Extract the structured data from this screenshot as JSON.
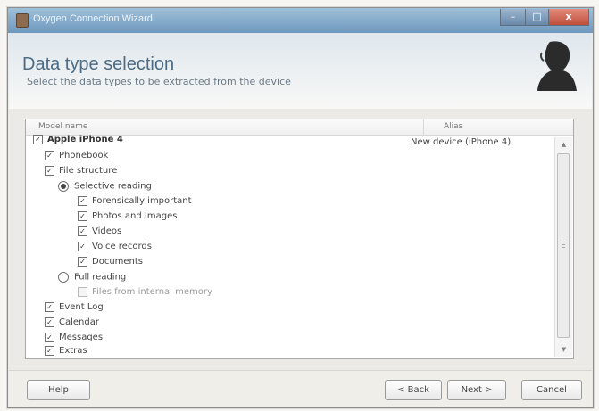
{
  "window": {
    "title": "Oxygen Connection Wizard",
    "controls": {
      "minimize": "–",
      "maximize": "□",
      "close": "x"
    }
  },
  "header": {
    "title": "Data type selection",
    "subtitle": "Select the data types to be extracted from the device"
  },
  "list": {
    "columns": {
      "model": "Model name",
      "alias": "Alias"
    },
    "device": {
      "name": "Apple iPhone 4",
      "alias": "New device (iPhone 4)",
      "checked": true
    },
    "items": [
      {
        "label": "Phonebook",
        "checked": true
      },
      {
        "label": "File structure",
        "checked": true
      },
      {
        "label": "Selective reading",
        "selected": true
      },
      {
        "label": "Forensically important",
        "checked": true
      },
      {
        "label": "Photos and Images",
        "checked": true
      },
      {
        "label": "Videos",
        "checked": true
      },
      {
        "label": "Voice records",
        "checked": true
      },
      {
        "label": "Documents",
        "checked": true
      },
      {
        "label": "Full reading",
        "selected": false
      },
      {
        "label": "Files from internal memory",
        "checked": false,
        "disabled": true
      },
      {
        "label": "Event Log",
        "checked": true
      },
      {
        "label": "Calendar",
        "checked": true
      },
      {
        "label": "Messages",
        "checked": true
      },
      {
        "label": "Extras",
        "checked": true
      }
    ]
  },
  "footer": {
    "help": "Help",
    "back": "< Back",
    "next": "Next >",
    "cancel": "Cancel"
  },
  "icons": {
    "app": "oxygen-app-icon",
    "logo": "silhouette-logo-icon",
    "check": "checkmark-icon",
    "radio": "radio-button-icon",
    "scroll_up": "chevron-up-icon",
    "scroll_down": "chevron-down-icon"
  },
  "colors": {
    "title_bar": "#6e98bd",
    "header_title": "#4c6b85",
    "close_button": "#bf4d3b",
    "panel_border": "#a9a9a9"
  }
}
